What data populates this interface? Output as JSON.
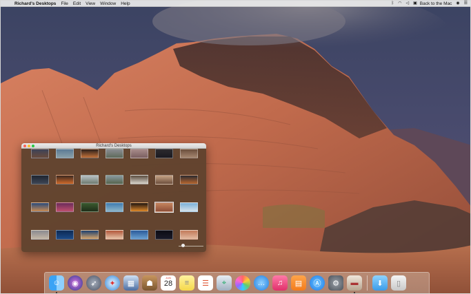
{
  "menubar": {
    "apple_icon": "apple-icon",
    "app_name": "Richard's Desktops",
    "menus": [
      "File",
      "Edit",
      "View",
      "Window",
      "Help"
    ],
    "status": {
      "bluetooth_icon": "bluetooth-icon",
      "wifi_icon": "wifi-icon",
      "volume_icon": "volume-icon",
      "back_to_mac_label": "Back to the Mac"
    }
  },
  "window": {
    "title": "Richard's Desktops"
  },
  "dock": {
    "calendar_month": "JUN",
    "calendar_day": "28"
  },
  "colors": {
    "menubar_bg": "#ececec",
    "window_bg": "#5c422d",
    "close": "#fc5f57",
    "minimize": "#fdbc2e",
    "maximize": "#28c840"
  }
}
